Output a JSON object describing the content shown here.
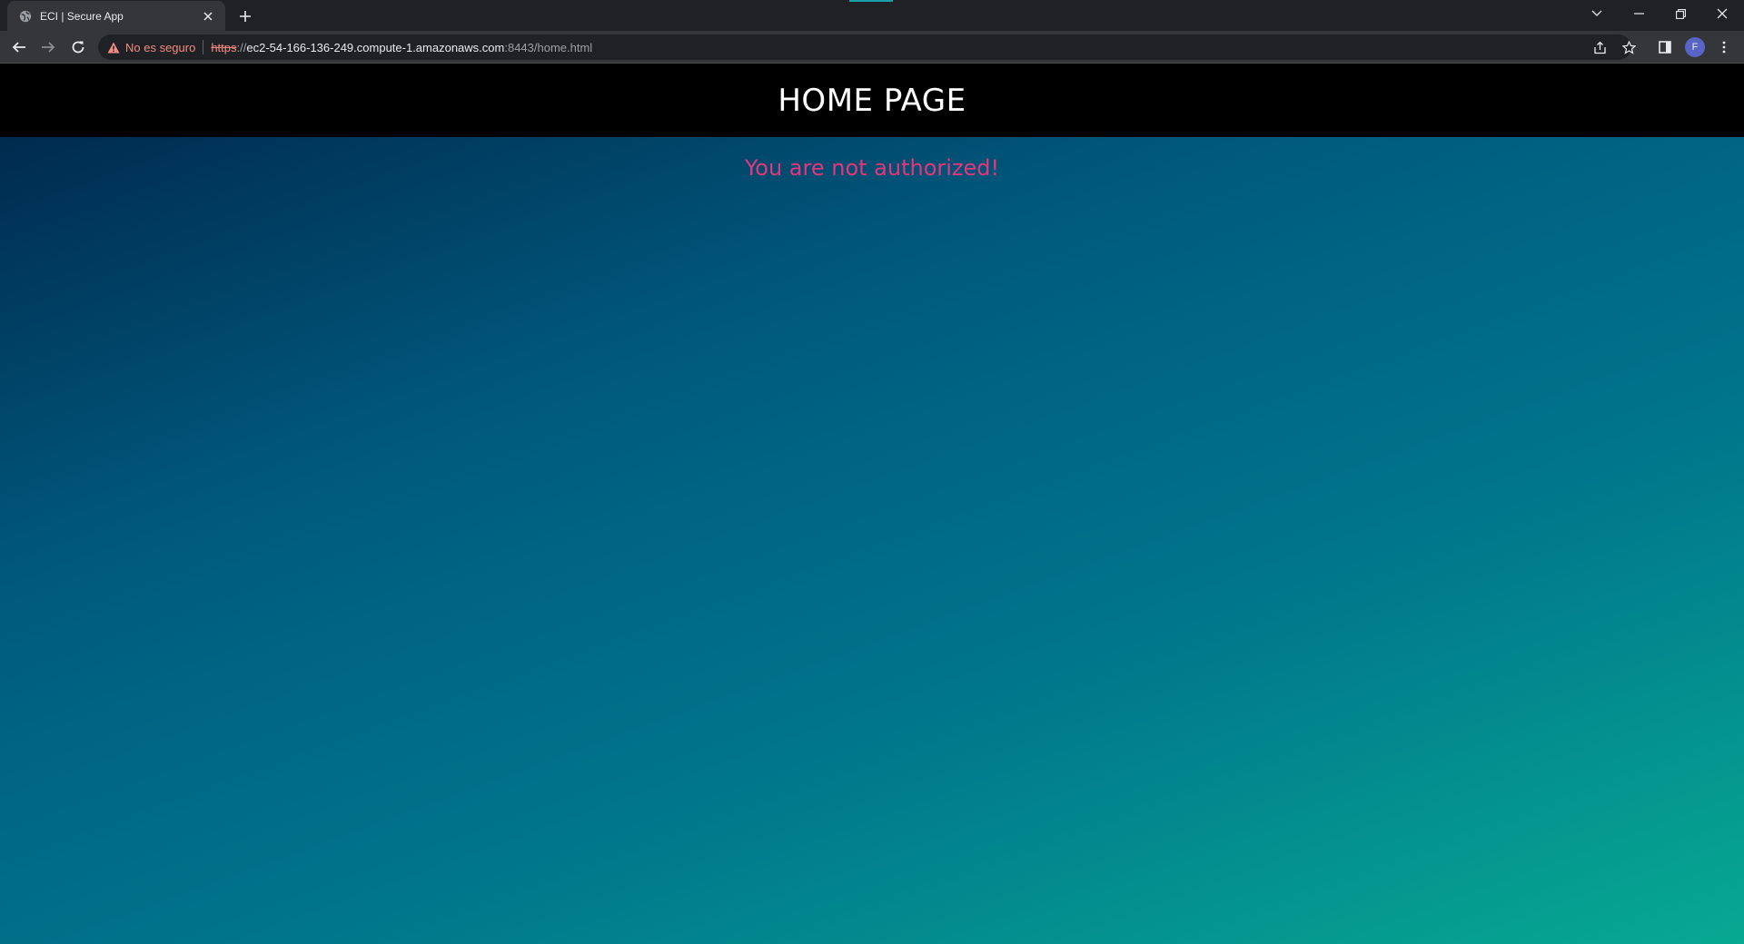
{
  "browser": {
    "tab": {
      "title": "ECI | Secure App"
    },
    "address_bar": {
      "security_label": "No es seguro",
      "url_scheme": "https",
      "url_scheme_rest": "://",
      "url_host": "ec2-54-166-136-249.compute-1.amazonaws.com",
      "url_path": ":8443/home.html"
    },
    "profile_initial": "F",
    "icons": [
      "globe-icon",
      "close-icon",
      "plus-icon",
      "chevron-down-icon",
      "minimize-icon",
      "restore-icon",
      "back-icon",
      "forward-icon",
      "reload-icon",
      "warning-icon",
      "share-icon",
      "star-icon",
      "side-panel-icon",
      "more-vert-icon"
    ],
    "colors": {
      "security_warning": "#f28b82",
      "chrome_dark": "#202124",
      "chrome_toolbar": "#35363a"
    }
  },
  "page": {
    "header_title": "HOME PAGE",
    "message": "You are not authorized!",
    "colors": {
      "header_bg": "#000000",
      "message": "#e8357a",
      "gradient_start": "#002347",
      "gradient_end": "#07a992"
    }
  }
}
